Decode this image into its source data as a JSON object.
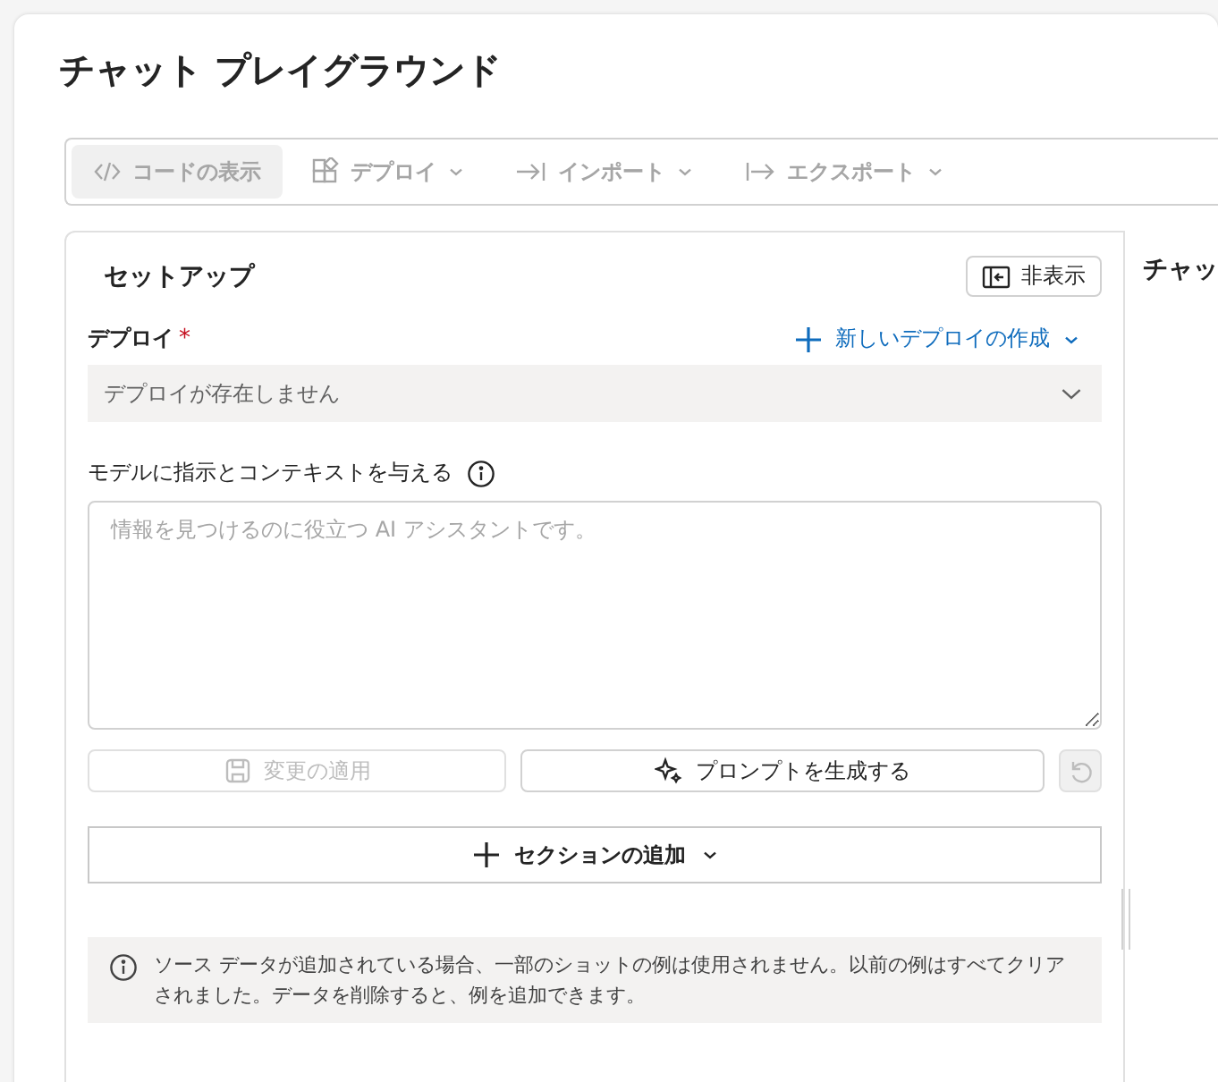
{
  "page": {
    "title": "チャット プレイグラウンド"
  },
  "toolbar": [
    {
      "kind": "code",
      "label": "コードの表示",
      "selected": true,
      "disabled": true,
      "dropdown": false
    },
    {
      "kind": "deploy",
      "label": "デプロイ",
      "selected": false,
      "disabled": true,
      "dropdown": true
    },
    {
      "kind": "import",
      "label": "インポート",
      "selected": false,
      "disabled": true,
      "dropdown": true
    },
    {
      "kind": "export",
      "label": "エクスポート",
      "selected": false,
      "disabled": true,
      "dropdown": true
    }
  ],
  "setup": {
    "title": "セットアップ",
    "hide_button": "非表示",
    "deployment": {
      "label": "デプロイ",
      "required_mark": "*",
      "create_link": "新しいデプロイの作成",
      "value": "デプロイが存在しません"
    },
    "instructions": {
      "label": "モデルに指示とコンテキストを与える",
      "placeholder": "情報を見つけるのに役立つ AI アシスタントです。"
    },
    "actions": [
      {
        "kind": "apply",
        "label": "変更の適用",
        "disabled": true
      },
      {
        "kind": "generate",
        "label": "プロンプトを生成する",
        "disabled": false
      },
      {
        "kind": "reset",
        "disabled": true
      }
    ],
    "add_section": "セクションの追加",
    "notice": "ソース データが追加されている場合、一部のショットの例は使用されません。以前の例はすべてクリアされました。データを削除すると、例を追加できます。"
  },
  "chat": {
    "title": "チャッ"
  }
}
